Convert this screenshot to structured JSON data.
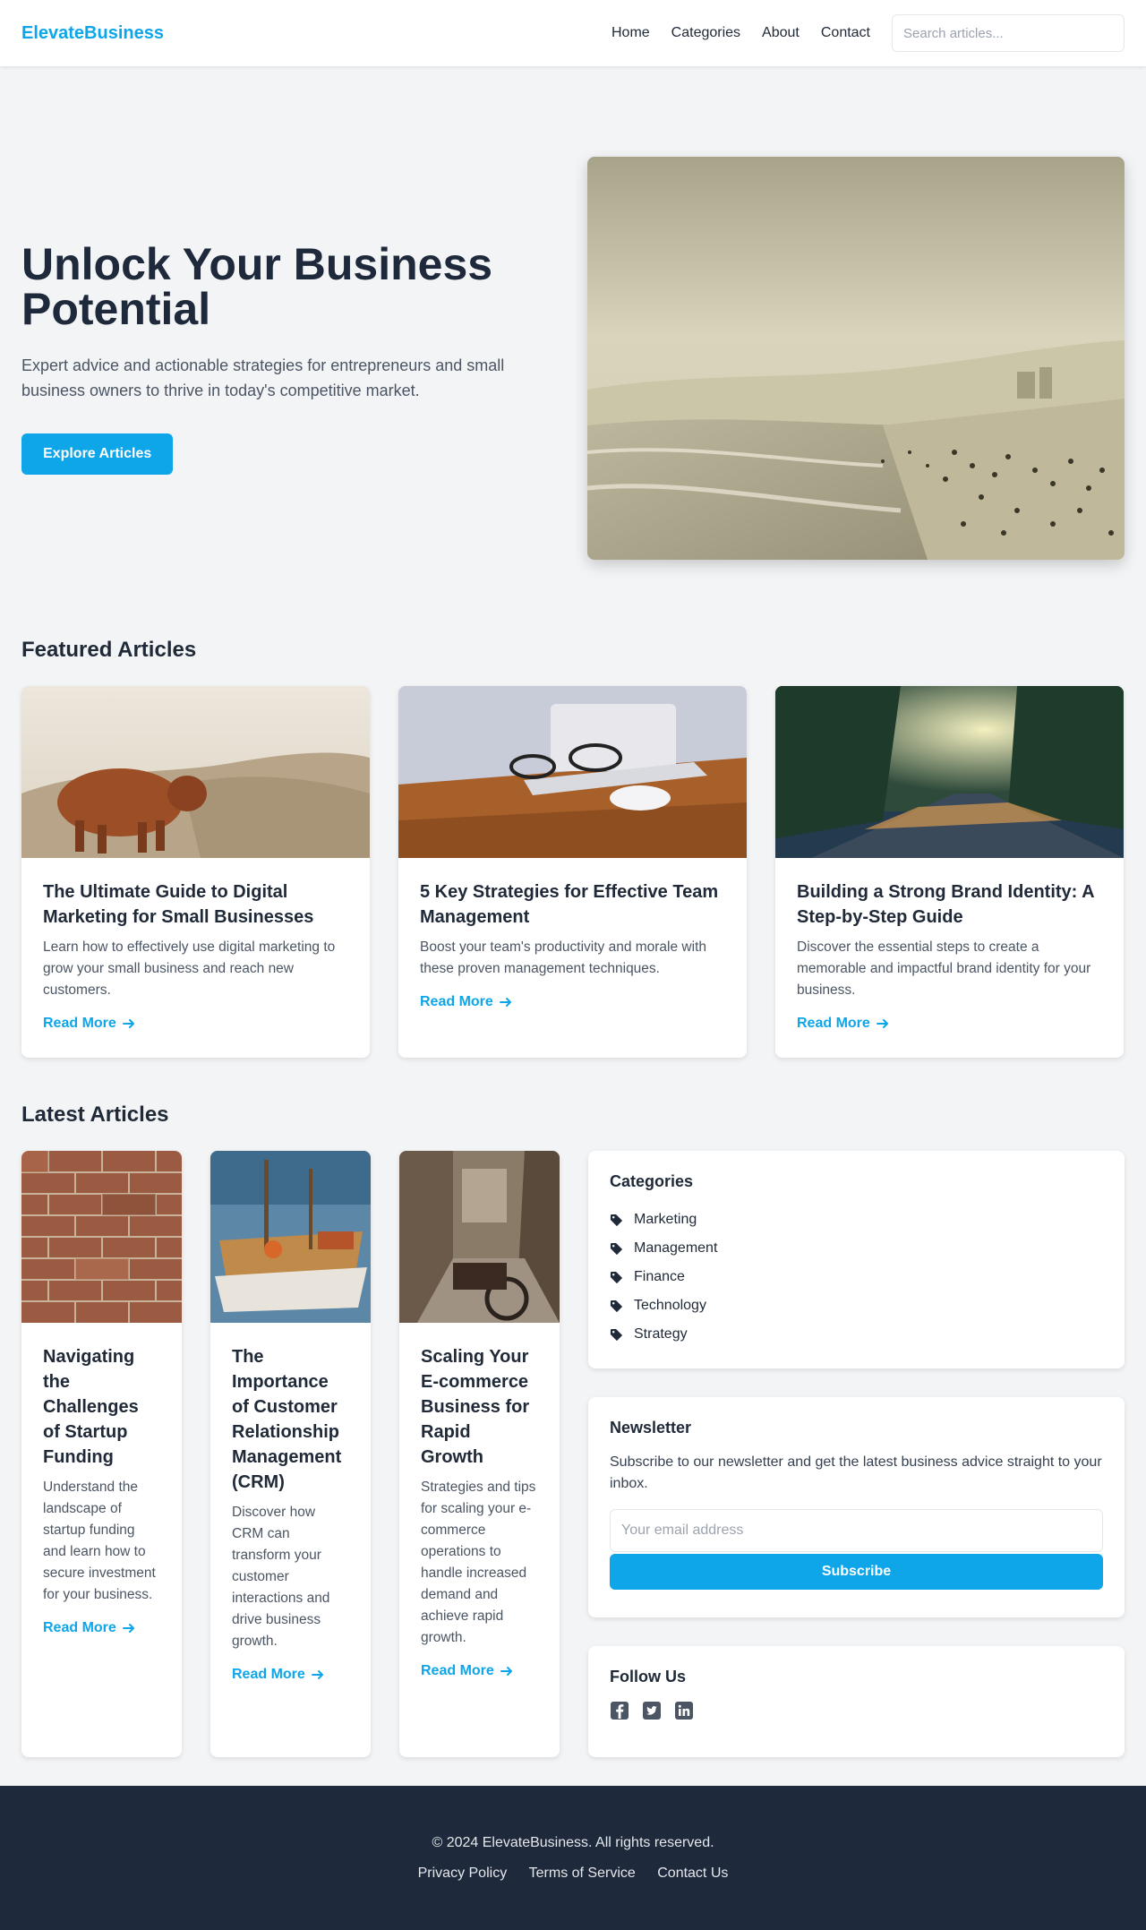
{
  "header": {
    "brand": "ElevateBusiness",
    "nav": [
      "Home",
      "Categories",
      "About",
      "Contact"
    ],
    "search_placeholder": "Search articles..."
  },
  "hero": {
    "title": "Unlock Your Business Potential",
    "subtitle": "Expert advice and actionable strategies for entrepreneurs and small business owners to thrive in today's competitive market.",
    "cta": "Explore Articles"
  },
  "featured": {
    "title": "Featured Articles",
    "articles": [
      {
        "title": "The Ultimate Guide to Digital Marketing for Small Businesses",
        "desc": "Learn how to effectively use digital marketing to grow your small business and reach new customers.",
        "link": "Read More"
      },
      {
        "title": "5 Key Strategies for Effective Team Management",
        "desc": "Boost your team's productivity and morale with these proven management techniques.",
        "link": "Read More"
      },
      {
        "title": "Building a Strong Brand Identity: A Step-by-Step Guide",
        "desc": "Discover the essential steps to create a memorable and impactful brand identity for your business.",
        "link": "Read More"
      }
    ]
  },
  "latest": {
    "title": "Latest Articles",
    "articles": [
      {
        "title": "Navigating the Challenges of Startup Funding",
        "desc": "Understand the landscape of startup funding and learn how to secure investment for your business.",
        "link": "Read More"
      },
      {
        "title": "The Importance of Customer Relationship Management (CRM)",
        "desc": "Discover how CRM can transform your customer interactions and drive business growth.",
        "link": "Read More"
      },
      {
        "title": "Scaling Your E-commerce Business for Rapid Growth",
        "desc": "Strategies and tips for scaling your e-commerce operations to handle increased demand and achieve rapid growth.",
        "link": "Read More"
      }
    ]
  },
  "sidebar": {
    "categories": {
      "title": "Categories",
      "items": [
        "Marketing",
        "Management",
        "Finance",
        "Technology",
        "Strategy"
      ]
    },
    "newsletter": {
      "title": "Newsletter",
      "text": "Subscribe to our newsletter and get the latest business advice straight to your inbox.",
      "email_placeholder": "Your email address",
      "button": "Subscribe"
    },
    "follow": {
      "title": "Follow Us",
      "icons": [
        "facebook-icon",
        "twitter-icon",
        "linkedin-icon"
      ]
    }
  },
  "footer": {
    "copyright": "© 2024 ElevateBusiness. All rights reserved.",
    "links": [
      "Privacy Policy",
      "Terms of Service",
      "Contact Us"
    ]
  },
  "colors": {
    "accent": "#0ea5e9",
    "dark": "#1e293b",
    "background": "#f3f4f6"
  }
}
